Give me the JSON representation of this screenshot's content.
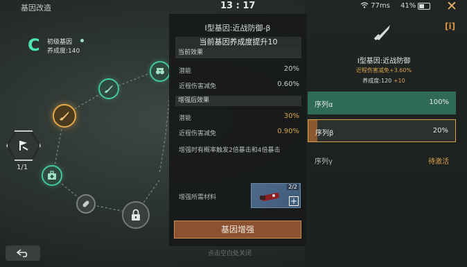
{
  "status_bar": {
    "screen_title": "基因改造",
    "time": "13 : 17",
    "ping": "77ms",
    "battery": "41%"
  },
  "tree": {
    "grade_letter": "C",
    "grade_name": "初级基因",
    "grade_progress": "养成度:140",
    "slot_count": "1/1"
  },
  "detail": {
    "title": "I型基因:近战防御-β",
    "subtitle": "当前基因养成度提升10",
    "current_header": "当前效果",
    "current_rows": [
      {
        "label": "潜能",
        "value": "20%"
      },
      {
        "label": "近程伤害减免",
        "value": "0.60%"
      }
    ],
    "enhanced_header": "增强后效果",
    "enhanced_rows": [
      {
        "label": "潜能",
        "value": "30%"
      },
      {
        "label": "近程伤害减免",
        "value": "0.90%"
      }
    ],
    "note": "增强时有概率触发2倍暴击和4倍暴击",
    "material_label": "增强所需材料",
    "material_count": "2/2",
    "enhance_button": "基因增强",
    "hint": "点击空白处关闭"
  },
  "gene": {
    "name": "I型基因:近战防御",
    "bonus": "近程伤害减免+3.60%",
    "nurture": "养成度:120",
    "nurture_plus": "+10",
    "sequences": [
      {
        "label": "序列α",
        "value": "100%",
        "fill": 1.0
      },
      {
        "label": "序列β",
        "value": "20%",
        "fill": 0.2
      },
      {
        "label": "序列γ",
        "value": "待激活"
      }
    ]
  },
  "colors": {
    "accent_green": "#43c99a",
    "accent_gold": "#d9a348",
    "button_brown": "#8a5230"
  }
}
